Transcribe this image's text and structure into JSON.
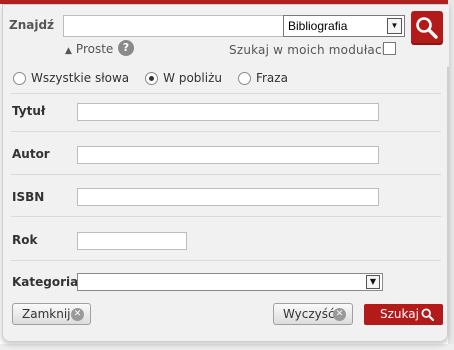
{
  "colors": {
    "accent": "#b31b1b",
    "panel": "#f1f1f1"
  },
  "search": {
    "label": "Znajdź",
    "query_value": "",
    "scope_value": "Bibliografia",
    "go_icon": "search-icon",
    "simple_link": "Proste",
    "help_icon": "?",
    "my_modules_label": "Szukaj w moich modułach",
    "my_modules_checked": false
  },
  "advanced": {
    "modes": [
      {
        "label": "Wszystkie słowa",
        "selected": false
      },
      {
        "label": "W pobliżu",
        "selected": true
      },
      {
        "label": "Fraza",
        "selected": false
      }
    ],
    "fields": {
      "title": {
        "label": "Tytuł",
        "value": ""
      },
      "author": {
        "label": "Autor",
        "value": ""
      },
      "isbn": {
        "label": "ISBN",
        "value": ""
      },
      "year": {
        "label": "Rok",
        "value": ""
      },
      "category": {
        "label": "Kategoria",
        "value": ""
      }
    },
    "buttons": {
      "close": "Zamknij",
      "clear": "Wyczyść",
      "search": "Szukaj"
    }
  }
}
